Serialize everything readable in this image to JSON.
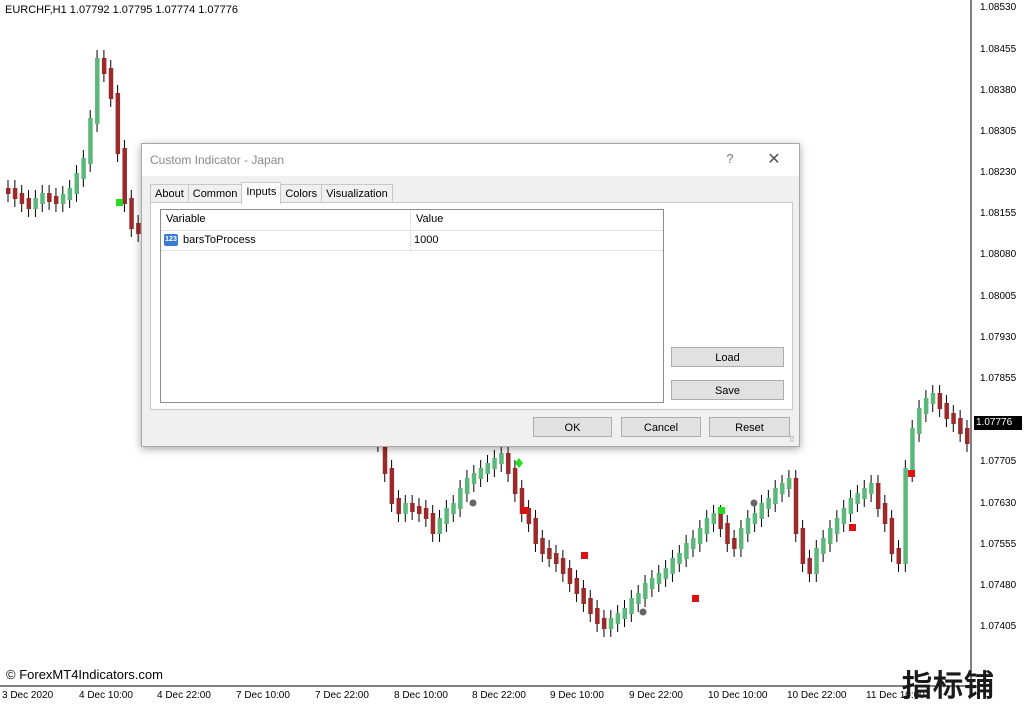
{
  "chart": {
    "symbol_line": "EURCHF,H1  1.07792 1.07795 1.07774 1.07776",
    "price_labels": [
      "1.08530",
      "1.08455",
      "1.08380",
      "1.08305",
      "1.08230",
      "1.08155",
      "1.08080",
      "1.08005",
      "1.07930",
      "1.07855",
      "1.07705",
      "1.07630",
      "1.07555",
      "1.07480",
      "1.07405"
    ],
    "current_price": "1.07776",
    "time_labels": [
      "3 Dec 2020",
      "4 Dec 10:00",
      "4 Dec 22:00",
      "7 Dec 10:00",
      "7 Dec 22:00",
      "8 Dec 10:00",
      "8 Dec 22:00",
      "9 Dec 10:00",
      "9 Dec 22:00",
      "10 Dec 10:00",
      "10 Dec 22:00",
      "11 Dec 10:00"
    ],
    "watermark": "© ForexMT4Indicators.com",
    "brand_badge": "指标铺",
    "colors": {
      "bull": "#5cb87a",
      "bear": "#9c2a2a",
      "signal_up": "#22dd22",
      "signal_down": "#dd1111",
      "neutral": "#666666"
    }
  },
  "dialog": {
    "title": "Custom Indicator - Japan",
    "help_icon": "?",
    "close_icon": "✕",
    "tabs": [
      "About",
      "Common",
      "Inputs",
      "Colors",
      "Visualization"
    ],
    "active_tab": "Inputs",
    "grid": {
      "col_variable": "Variable",
      "col_value": "Value",
      "rows": [
        {
          "icon": "123",
          "name": "barsToProcess",
          "value": "1000"
        }
      ]
    },
    "buttons": {
      "load": "Load",
      "save": "Save",
      "ok": "OK",
      "cancel": "Cancel",
      "reset": "Reset"
    }
  }
}
